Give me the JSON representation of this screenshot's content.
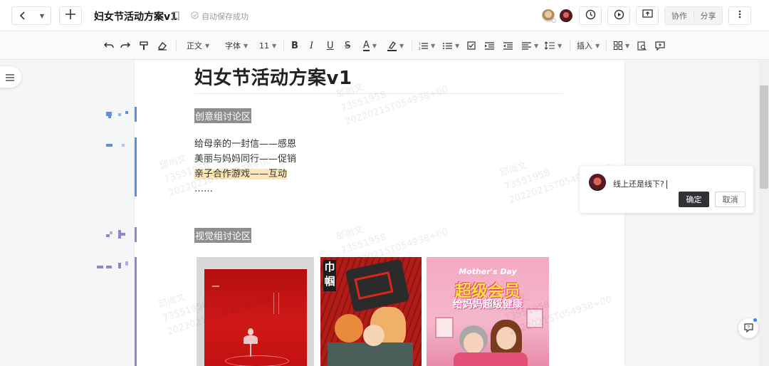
{
  "header": {
    "doc_title": "妇女节活动方案v1",
    "save_status": "自动保存成功",
    "collab_label": "协作",
    "share_label": "分享"
  },
  "toolbar": {
    "style_label": "正文",
    "font_label": "字体",
    "size_label": "11",
    "insert_label": "插入"
  },
  "document": {
    "title": "妇女节活动方案v1",
    "section1": "创意组讨论区",
    "lines": [
      "给母亲的一封信——感恩",
      "美丽与妈妈同行——促销",
      "亲子合作游戏——互动",
      "……"
    ],
    "section2": "视觉组讨论区",
    "watermark": [
      "邱尚文",
      "73551958",
      "20220215T054938+00"
    ]
  },
  "images": {
    "poster2_text": [
      "巾",
      "帼"
    ],
    "poster3_title": "Mother's Day",
    "poster3_big": "超级会员",
    "poster3_sub": "给妈妈超级健康"
  },
  "comment": {
    "text": "线上还是线下?",
    "confirm_label": "确定",
    "cancel_label": "取消"
  },
  "colors": {
    "accent": "#5b8fe3",
    "highlight_bg": "#8e8e8e",
    "yellow_highlight": "#fde8b4",
    "confirm_bg": "#2f3135"
  }
}
